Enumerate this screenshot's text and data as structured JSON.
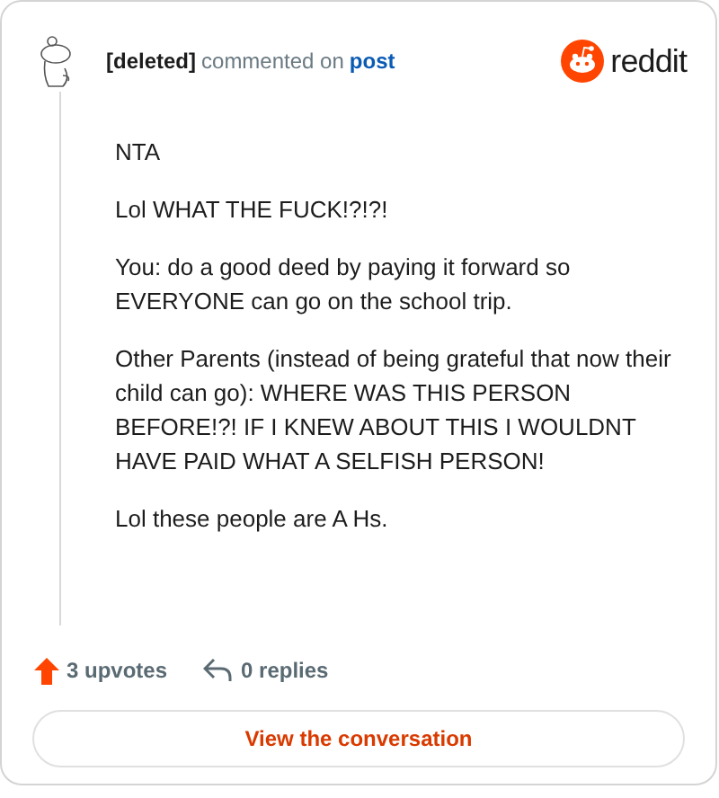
{
  "header": {
    "author": "[deleted]",
    "action": "commented on",
    "link": "post",
    "brand": "reddit"
  },
  "comment": {
    "paragraphs": [
      "NTA",
      "Lol WHAT THE FUCK!?!?!",
      "You: do a good deed by paying it forward so EVERYONE can go on the school trip.",
      "Other Parents (instead of being grateful that now their child can go): WHERE WAS THIS PERSON BEFORE!?! IF I KNEW ABOUT THIS I WOULDNT HAVE PAID WHAT A SELFISH PERSON!",
      "Lol these people are A Hs."
    ]
  },
  "footer": {
    "upvotes": "3 upvotes",
    "replies": "0 replies"
  },
  "button": {
    "label": "View the conversation"
  }
}
